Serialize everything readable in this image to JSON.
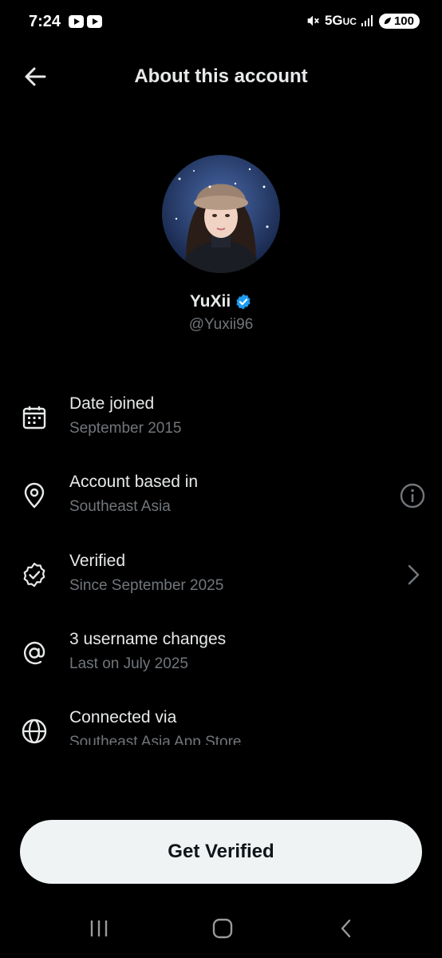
{
  "status_bar": {
    "time": "7:24",
    "network": "5G",
    "network_suffix": "UC",
    "battery": "100"
  },
  "header": {
    "title": "About this account"
  },
  "profile": {
    "display_name": "YuXii",
    "username": "@Yuxii96",
    "verified": true
  },
  "info_rows": [
    {
      "icon": "calendar-icon",
      "title": "Date joined",
      "subtitle": "September 2015"
    },
    {
      "icon": "location-pin-icon",
      "title": "Account based in",
      "subtitle": "Southeast Asia",
      "trailing": "info-icon"
    },
    {
      "icon": "verified-check-icon",
      "title": "Verified",
      "subtitle": "Since September 2025",
      "trailing": "chevron-right-icon"
    },
    {
      "icon": "at-sign-icon",
      "title": "3 username changes",
      "subtitle": "Last on July 2025"
    },
    {
      "icon": "globe-icon",
      "title": "Connected via",
      "subtitle": "Southeast Asia App Store"
    }
  ],
  "cta": {
    "label": "Get Verified"
  },
  "colors": {
    "background": "#000000",
    "primary_text": "#e7e9ea",
    "secondary_text": "#71767b",
    "verified_blue": "#1d9bf0",
    "cta_background": "#eff3f4"
  }
}
